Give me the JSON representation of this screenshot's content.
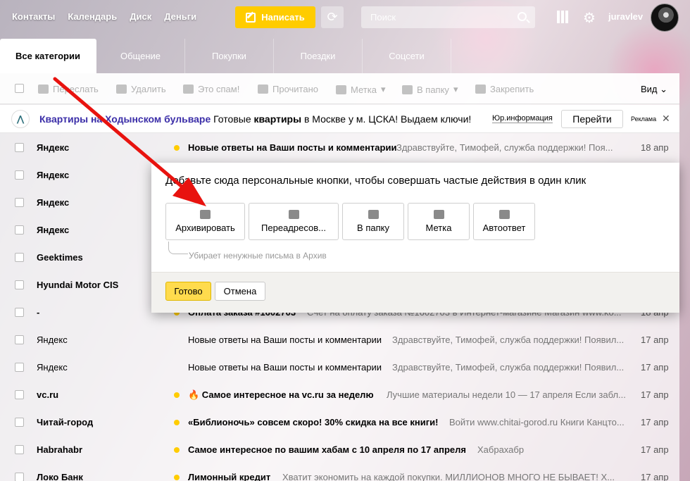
{
  "nav": [
    "Контакты",
    "Календарь",
    "Диск",
    "Деньги"
  ],
  "compose_label": "Написать",
  "search_placeholder": "Поиск",
  "username": "juravlev",
  "tabs": [
    "Все категории",
    "Общение",
    "Покупки",
    "Поездки",
    "Соцсети"
  ],
  "toolbar": {
    "forward": "Переслать",
    "delete": "Удалить",
    "spam": "Это спам!",
    "read": "Прочитано",
    "label": "Метка",
    "folder": "В папку",
    "pin": "Закрепить",
    "view": "Вид"
  },
  "ad": {
    "link": "Квартиры на Ходынском бульваре",
    "text_pre": " Готовые ",
    "text_bold": "квартиры",
    "text_post": " в Москве у м. ЦСКА! Выдаем ключи!",
    "info": "Юр.информация",
    "button": "Перейти",
    "label": "Реклама"
  },
  "emails": [
    {
      "sender": "Яндекс",
      "unread": true,
      "subject": "Новые ответы на Ваши посты и комментарии",
      "snippet": "Здравствуйте, Тимофей, служба поддержки! Поя...",
      "date": "18 апр"
    },
    {
      "sender": "Яндекс",
      "unread": true,
      "subject": "",
      "snippet": "",
      "date": ""
    },
    {
      "sender": "Яндекс",
      "unread": true,
      "subject": "",
      "snippet": "",
      "date": ""
    },
    {
      "sender": "Яндекс",
      "unread": true,
      "subject": "",
      "snippet": "",
      "date": ""
    },
    {
      "sender": "Geektimes",
      "unread": true,
      "subject": "",
      "snippet": "",
      "date": ""
    },
    {
      "sender": "Hyundai Motor CIS",
      "unread": true,
      "subject": "",
      "snippet": "",
      "date": ""
    },
    {
      "sender": "-",
      "unread": true,
      "subject": "Оплата заказа #1602703",
      "snippet": "Счет на оплату заказа №1602703 в Интернет-магазине Магазин www.ko...",
      "date": "18 апр"
    },
    {
      "sender": "Яндекс",
      "unread": false,
      "subject": "Новые ответы на Ваши посты и комментарии",
      "snippet": "Здравствуйте, Тимофей, служба поддержки! Появил...",
      "date": "17 апр"
    },
    {
      "sender": "Яндекс",
      "unread": false,
      "subject": "Новые ответы на Ваши посты и комментарии",
      "snippet": "Здравствуйте, Тимофей, служба поддержки! Появил...",
      "date": "17 апр"
    },
    {
      "sender": "vc.ru",
      "unread": true,
      "subject": "🔥 Самое интересное на vc.ru за неделю",
      "snippet": "Лучшие материалы недели 10 — 17 апреля Если забл...",
      "date": "17 апр"
    },
    {
      "sender": "Читай-город",
      "unread": true,
      "subject": "«Библионочь» совсем скоро! 30% скидка на все книги!",
      "snippet": "Войти www.chitai-gorod.ru Книги Канцто...",
      "date": "17 апр"
    },
    {
      "sender": "Habrahabr",
      "unread": true,
      "subject": "Самое интересное по вашим хабам с 10 апреля по 17 апреля",
      "snippet": "Хабрахабр",
      "date": "17 апр"
    },
    {
      "sender": "Локо Банк",
      "unread": true,
      "subject": "Лимонный кредит",
      "snippet": "Хватит экономить на каждой покупки. МИЛЛИОНОВ МНОГО НЕ БЫВАЕТ! Х...",
      "date": "17 апр"
    }
  ],
  "dialog": {
    "title": "Добавьте сюда персональные кнопки, чтобы совершать частые действия в один клик",
    "buttons": [
      "Архивировать",
      "Переадресов...",
      "В папку",
      "Метка",
      "Автоответ"
    ],
    "hint": "Убирает ненужные письма в Архив",
    "ok": "Готово",
    "cancel": "Отмена"
  },
  "colors": {
    "accent": "#ffcc00",
    "ad_link": "#3b2ea8",
    "arrow": "#e8130f"
  }
}
